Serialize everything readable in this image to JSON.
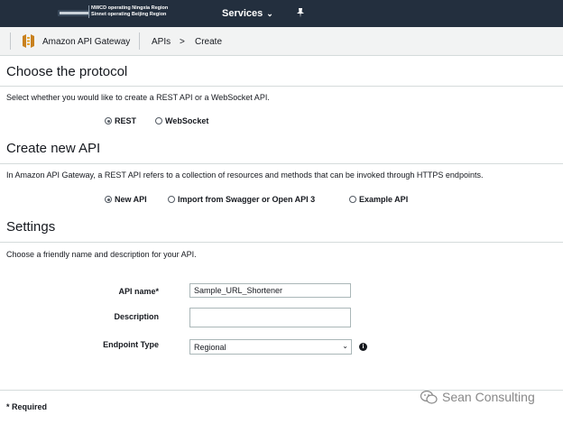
{
  "topbar": {
    "region_line1": "NWCD operating Ningxia Region",
    "region_line2": "Sinnet operating Beijing Region",
    "services_label": "Services",
    "services_chevron": "⌄",
    "pin_icon": "pin-icon"
  },
  "breadcrumb": {
    "service_name": "Amazon API Gateway",
    "apis": "APIs",
    "separator": ">",
    "current": "Create"
  },
  "protocol": {
    "title": "Choose the protocol",
    "description": "Select whether you would like to create a REST API or a WebSocket API.",
    "options": [
      {
        "label": "REST",
        "selected": true
      },
      {
        "label": "WebSocket",
        "selected": false
      }
    ]
  },
  "create": {
    "title": "Create new API",
    "description": "In Amazon API Gateway, a REST API refers to a collection of resources and methods that can be invoked through HTTPS endpoints.",
    "options": [
      {
        "label": "New API",
        "selected": true
      },
      {
        "label": "Import from Swagger or Open API 3",
        "selected": false
      },
      {
        "label": "Example API",
        "selected": false
      }
    ]
  },
  "settings": {
    "title": "Settings",
    "description": "Choose a friendly name and description for your API.",
    "api_name_label": "API name*",
    "api_name_value": "Sample_URL_Shortener",
    "description_label": "Description",
    "description_value": "",
    "endpoint_label": "Endpoint Type",
    "endpoint_value": "Regional"
  },
  "footer": {
    "required_note": "* Required",
    "watermark": "Sean Consulting"
  },
  "colors": {
    "topbar": "#232f3e",
    "crumbbar": "#f2f3f3",
    "text": "#16191f"
  }
}
